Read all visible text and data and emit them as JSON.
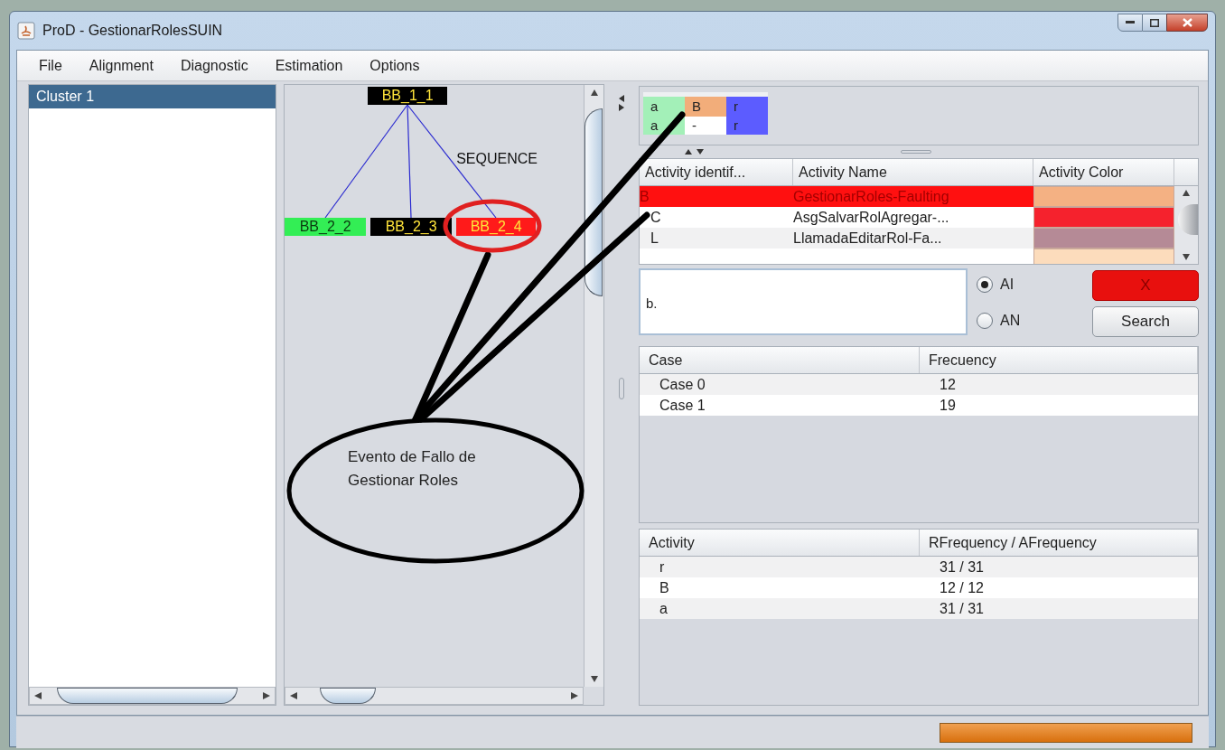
{
  "window": {
    "title": "ProD - GestionarRolesSUIN"
  },
  "menu": [
    "File",
    "Alignment",
    "Diagnostic",
    "Estimation",
    "Options"
  ],
  "clusters": [
    {
      "label": "Cluster 1",
      "selected": true
    }
  ],
  "tree": {
    "label": "BB_1_1",
    "color": "#000000",
    "operator": "SEQUENCE",
    "children": [
      {
        "label": "BB_2_2",
        "color": "#33ee55"
      },
      {
        "label": "BB_2_3",
        "color": "#000000"
      },
      {
        "label": "BB_2_4",
        "color": "#ff1a1a"
      }
    ]
  },
  "alignment": [
    {
      "top": "a",
      "bottom": "a",
      "kind": "sync",
      "color": "#a3f0b8"
    },
    {
      "top": "B",
      "bottom": "-",
      "kind": "log_only",
      "color": "#f2ad7a"
    },
    {
      "top": "r",
      "bottom": "r",
      "kind": "sync",
      "color": "#5c5cff"
    }
  ],
  "activities": {
    "columns": [
      "Activity identif...",
      "Activity Name",
      "Activity Color"
    ],
    "rows": [
      {
        "id": "B",
        "name": "GestionarRoles-Faulting",
        "color": "#f4b183",
        "selected": true
      },
      {
        "id": "C",
        "name": "AsgSalvarRolAgregar-...",
        "color": "#f5222d",
        "selected": false
      },
      {
        "id": "L",
        "name": "LlamadaEditarRol-Fa...",
        "color": "#b58a96",
        "selected": false
      },
      {
        "color": "#fcdcbc",
        "selected": false
      }
    ]
  },
  "search": {
    "value": "b.",
    "options": [
      {
        "label": "AI",
        "selected": true
      },
      {
        "label": "AN",
        "selected": false
      }
    ],
    "buttons": [
      {
        "label": "X",
        "kind": "clear"
      },
      {
        "label": "Search",
        "kind": "search"
      }
    ]
  },
  "cases": {
    "columns": [
      "Case",
      "Frecuency"
    ],
    "rows": [
      [
        "Case 0",
        "12"
      ],
      [
        "Case 1",
        "19"
      ]
    ]
  },
  "frequencies": {
    "columns": [
      "Activity",
      "RFrequency / AFrequency"
    ],
    "rows": [
      [
        "r",
        "31 / 31"
      ],
      [
        "B",
        "12 / 12"
      ],
      [
        "a",
        "31 / 31"
      ]
    ]
  },
  "progress": {
    "level": 1
  },
  "annotation": {
    "note": "Evento de Fallo de Gestionar Roles"
  }
}
